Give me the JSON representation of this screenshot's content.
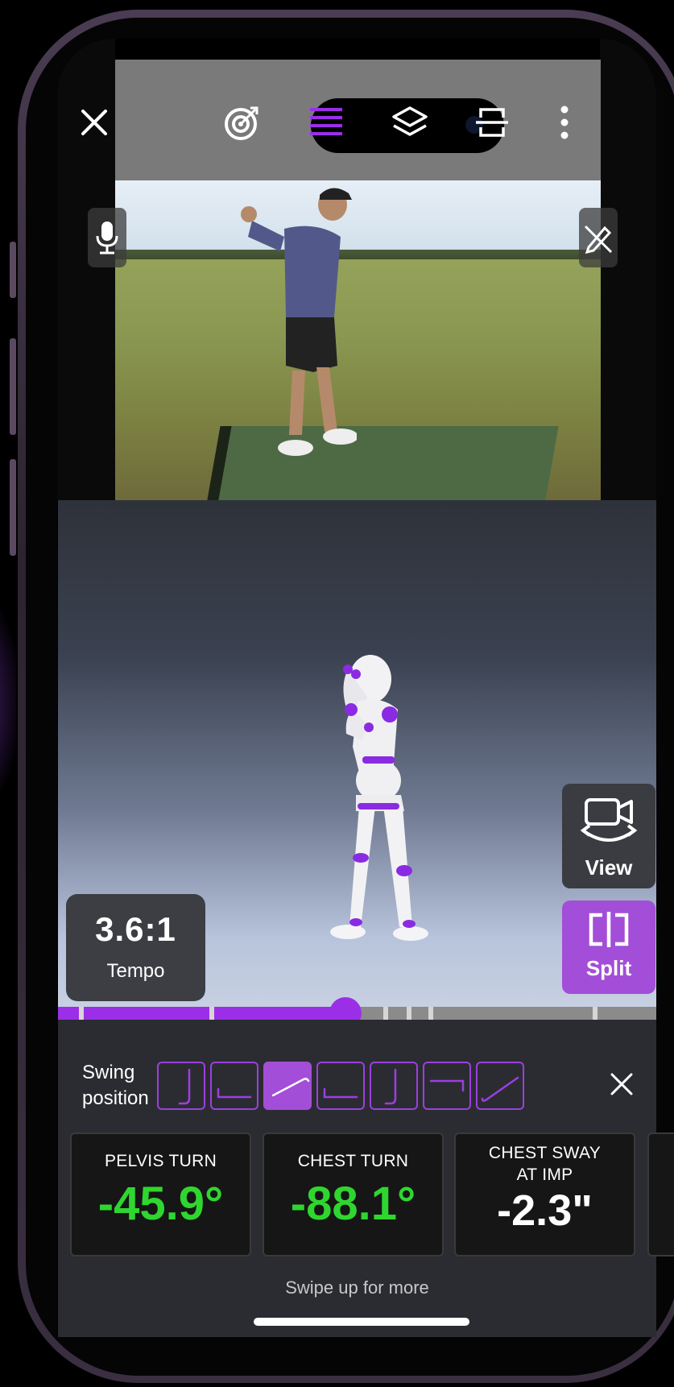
{
  "toolbar": {
    "close_icon": "close-icon",
    "target_icon": "target-icon",
    "lines_icon": "lines-icon",
    "layers_icon": "layers-icon",
    "compare_icon": "split-horizontal-icon",
    "more_icon": "more-vertical-icon"
  },
  "side": {
    "mic_icon": "microphone-icon",
    "draw_icon": "draw-off-icon"
  },
  "tempo": {
    "value": "3.6:1",
    "label": "Tempo"
  },
  "view_button": {
    "label": "View"
  },
  "split_button": {
    "label": "Split"
  },
  "timeline": {
    "progress": 0.48
  },
  "swing": {
    "label": "Swing\nposition",
    "positions_count": 7,
    "active_index": 2
  },
  "metrics": [
    {
      "title": "PELVIS TURN",
      "value": "-45.9°",
      "highlight": true
    },
    {
      "title": "CHEST TURN",
      "value": "-88.1°",
      "highlight": true
    },
    {
      "title": "CHEST SWAY\nAT IMP",
      "value": "-2.3\"",
      "highlight": false
    }
  ],
  "footer": {
    "swipe_text": "Swipe up for more"
  },
  "colors": {
    "accent": "#9b2fe8",
    "metric_green": "#2fd62f",
    "split_bg": "#a24ed8"
  }
}
